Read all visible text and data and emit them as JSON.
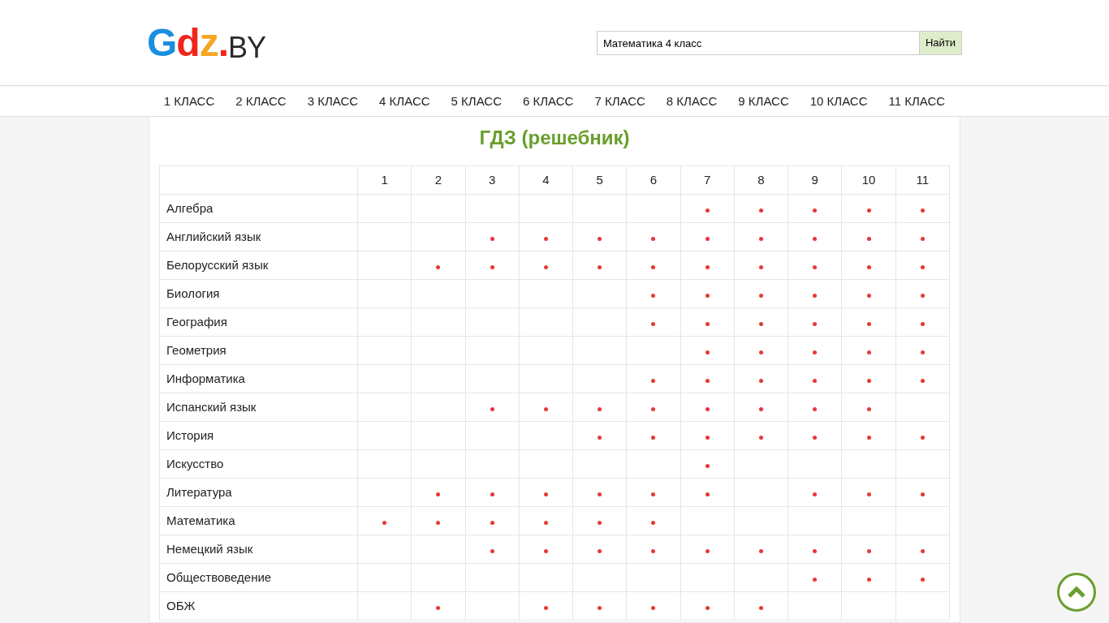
{
  "logo": [
    {
      "text": "G",
      "color": "#1a8fe0"
    },
    {
      "text": "d",
      "color": "#f0261c"
    },
    {
      "text": "z",
      "color": "#f5a623"
    },
    {
      "text": ".",
      "color": "#f0261c"
    },
    {
      "text": "BY",
      "color": "#2a2a2a"
    }
  ],
  "search": {
    "value": "Математика 4 класс",
    "button": "Найти"
  },
  "nav": [
    "1 КЛАСС",
    "2 КЛАСС",
    "3 КЛАСС",
    "4 КЛАСС",
    "5 КЛАСС",
    "6 КЛАСС",
    "7 КЛАСС",
    "8 КЛАСС",
    "9 КЛАСС",
    "10 КЛАСС",
    "11 КЛАСС"
  ],
  "title": "ГДЗ (решебник)",
  "table": {
    "columns": [
      "1",
      "2",
      "3",
      "4",
      "5",
      "6",
      "7",
      "8",
      "9",
      "10",
      "11"
    ],
    "rows": [
      {
        "subject": "Алгебра",
        "available": [
          false,
          false,
          false,
          false,
          false,
          false,
          true,
          true,
          true,
          true,
          true
        ]
      },
      {
        "subject": "Английский язык",
        "available": [
          false,
          false,
          true,
          true,
          true,
          true,
          true,
          true,
          true,
          true,
          true
        ]
      },
      {
        "subject": "Белорусский язык",
        "available": [
          false,
          true,
          true,
          true,
          true,
          true,
          true,
          true,
          true,
          true,
          true
        ]
      },
      {
        "subject": "Биология",
        "available": [
          false,
          false,
          false,
          false,
          false,
          true,
          true,
          true,
          true,
          true,
          true
        ]
      },
      {
        "subject": "География",
        "available": [
          false,
          false,
          false,
          false,
          false,
          true,
          true,
          true,
          true,
          true,
          true
        ]
      },
      {
        "subject": "Геометрия",
        "available": [
          false,
          false,
          false,
          false,
          false,
          false,
          true,
          true,
          true,
          true,
          true
        ]
      },
      {
        "subject": "Информатика",
        "available": [
          false,
          false,
          false,
          false,
          false,
          true,
          true,
          true,
          true,
          true,
          true
        ]
      },
      {
        "subject": "Испанский язык",
        "available": [
          false,
          false,
          true,
          true,
          true,
          true,
          true,
          true,
          true,
          true,
          false
        ]
      },
      {
        "subject": "История",
        "available": [
          false,
          false,
          false,
          false,
          true,
          true,
          true,
          true,
          true,
          true,
          true
        ]
      },
      {
        "subject": "Искусство",
        "available": [
          false,
          false,
          false,
          false,
          false,
          false,
          true,
          false,
          false,
          false,
          false
        ]
      },
      {
        "subject": "Литература",
        "available": [
          false,
          true,
          true,
          true,
          true,
          true,
          true,
          false,
          true,
          true,
          true
        ]
      },
      {
        "subject": "Математика",
        "available": [
          true,
          true,
          true,
          true,
          true,
          true,
          false,
          false,
          false,
          false,
          false
        ]
      },
      {
        "subject": "Немецкий язык",
        "available": [
          false,
          false,
          true,
          true,
          true,
          true,
          true,
          true,
          true,
          true,
          true
        ]
      },
      {
        "subject": "Обществоведение",
        "available": [
          false,
          false,
          false,
          false,
          false,
          false,
          false,
          false,
          true,
          true,
          true
        ]
      },
      {
        "subject": "ОБЖ",
        "available": [
          false,
          true,
          false,
          true,
          true,
          true,
          true,
          true,
          false,
          false,
          false
        ]
      }
    ]
  }
}
